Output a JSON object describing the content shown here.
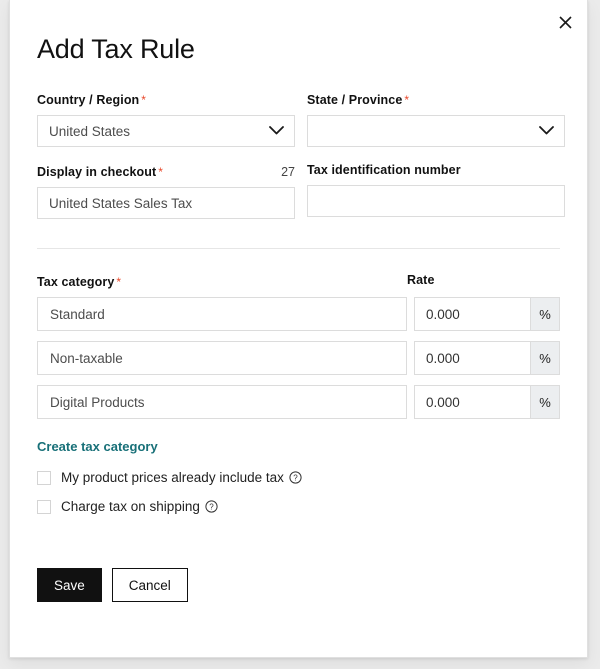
{
  "modal": {
    "title": "Add Tax Rule",
    "close_icon": "close-icon"
  },
  "form": {
    "country": {
      "label": "Country / Region",
      "required_marker": "*",
      "value": "United States",
      "icon": "chevron-down-icon"
    },
    "state": {
      "label": "State / Province",
      "required_marker": "*",
      "value": "",
      "placeholder": "",
      "icon": "chevron-down-icon"
    },
    "display_in_checkout": {
      "label": "Display in checkout",
      "required_marker": "*",
      "char_count": "27",
      "value": "United States Sales Tax"
    },
    "tax_id": {
      "label": "Tax identification number",
      "value": "",
      "placeholder": ""
    }
  },
  "categories": {
    "category_header": "Tax category",
    "category_required_marker": "*",
    "rate_header": "Rate",
    "percent_suffix": "%",
    "rows": [
      {
        "name": "Standard",
        "rate": "0.000"
      },
      {
        "name": "Non-taxable",
        "rate": "0.000"
      },
      {
        "name": "Digital Products",
        "rate": "0.000"
      }
    ],
    "create_link": "Create tax category"
  },
  "options": [
    {
      "label": "My product prices already include tax",
      "checked": false,
      "help_icon": "help-circle-icon"
    },
    {
      "label": "Charge tax on shipping",
      "checked": false,
      "help_icon": "help-circle-icon"
    }
  ],
  "footer": {
    "save_label": "Save",
    "cancel_label": "Cancel"
  },
  "colors": {
    "accent_link": "#187078",
    "required": "#e8472a",
    "primary_button_bg": "#111111",
    "percent_suffix_bg": "#eceef0"
  }
}
